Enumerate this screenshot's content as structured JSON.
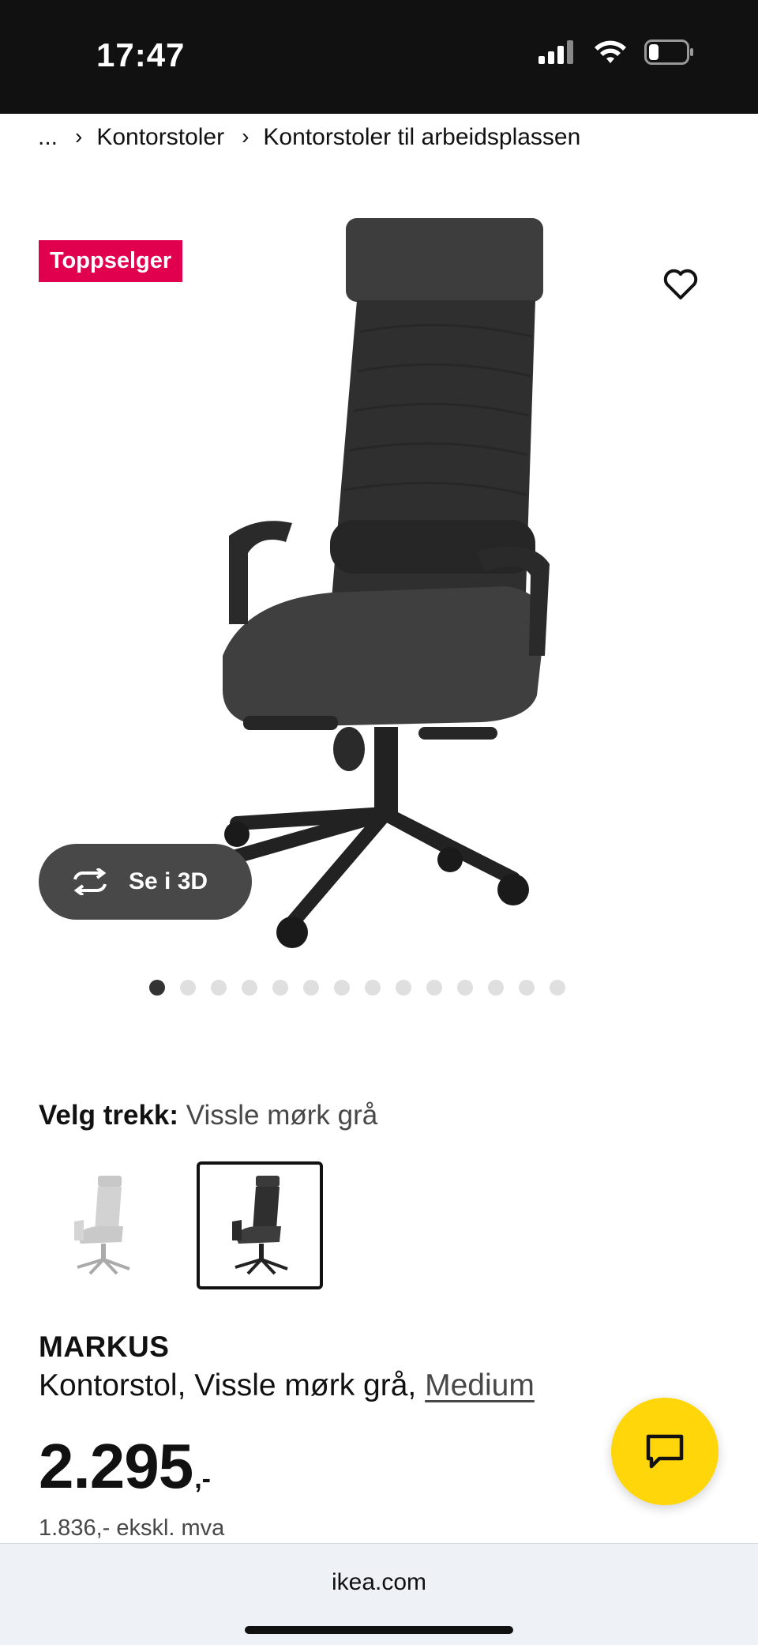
{
  "status_bar": {
    "time": "17:47"
  },
  "breadcrumb": {
    "ellipsis": "...",
    "items": [
      "Kontorstoler",
      "Kontorstoler til arbeidsplassen"
    ]
  },
  "gallery": {
    "badge": "Toppselger",
    "view_3d_label": "Se i 3D",
    "dot_count": 14,
    "active_dot": 0
  },
  "variant": {
    "label": "Velg trekk:",
    "value": "Vissle mørk grå",
    "swatches": [
      {
        "name": "light-grey-chair",
        "selected": false
      },
      {
        "name": "dark-grey-chair",
        "selected": true
      }
    ]
  },
  "product": {
    "name": "MARKUS",
    "description": "Kontorstol, Vissle mørk grå, ",
    "size_link": "Medium",
    "price_int": "2.295",
    "price_suffix": ",-",
    "price_ex_vat": "1.836,- ekskl. mva"
  },
  "browser": {
    "url": "ikea.com"
  },
  "colors": {
    "badge": "#e0004e",
    "chat_fab": "#ffd60a",
    "pill": "#484848"
  },
  "icons": [
    "wifi-icon",
    "signal-icon",
    "battery-icon",
    "heart-icon",
    "rotate-3d-icon",
    "chat-icon"
  ]
}
